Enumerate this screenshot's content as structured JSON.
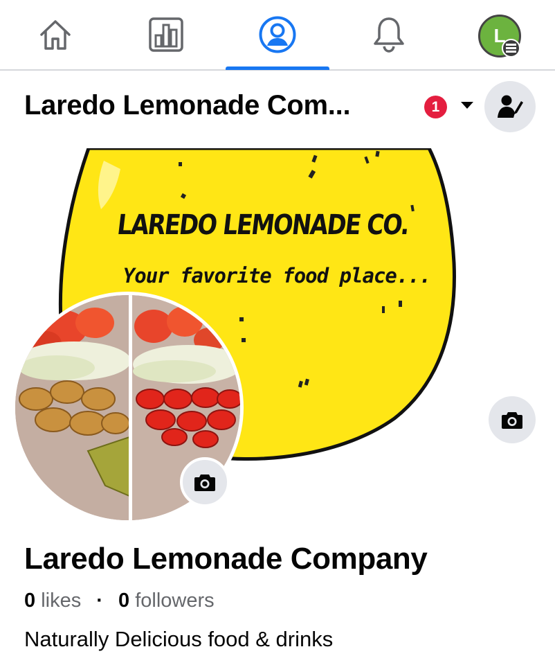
{
  "nav": {
    "tabs": [
      {
        "name": "home",
        "icon": "home-icon"
      },
      {
        "name": "insights",
        "icon": "bar-chart-icon"
      },
      {
        "name": "profile",
        "icon": "user-circle-icon",
        "active": true
      },
      {
        "name": "notifications",
        "icon": "bell-icon"
      },
      {
        "name": "menu",
        "icon": "avatar-menu-icon"
      }
    ],
    "avatar_letter": "L",
    "active_color": "#1877f2"
  },
  "header": {
    "title": "Laredo Lemonade Com...",
    "notification_count": "1",
    "dropdown_icon": "caret-down-icon",
    "admin_icon": "user-edit-icon"
  },
  "cover": {
    "brand_text": "LAREDO LEMONADE CO.",
    "tagline": "Your favorite food place...",
    "logo_color": "#ffe615",
    "camera_icon": "camera-icon"
  },
  "profile_photo": {
    "camera_icon": "camera-icon"
  },
  "page": {
    "name": "Laredo Lemonade Company",
    "likes_count": "0",
    "likes_label": "likes",
    "separator": "·",
    "followers_count": "0",
    "followers_label": "followers",
    "bio": "Naturally Delicious food & drinks"
  }
}
